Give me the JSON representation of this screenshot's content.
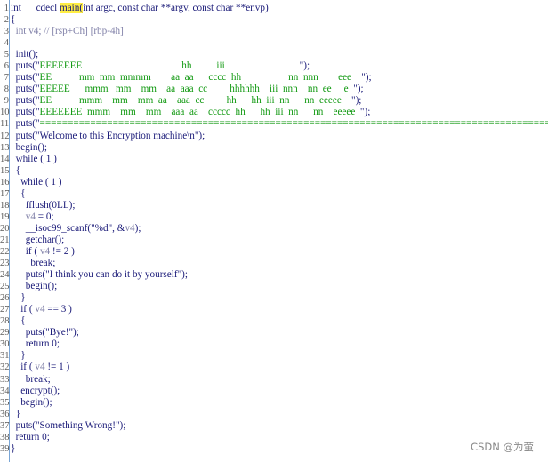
{
  "code": {
    "lines": [
      {
        "n": "1",
        "tokens": [
          {
            "t": "int  __cdecl ",
            "c": "code"
          },
          {
            "t": "main(",
            "c": "hl"
          },
          {
            "t": "int argc, const char **argv, const char **envp)",
            "c": "code"
          }
        ]
      },
      {
        "n": "2",
        "tokens": [
          {
            "t": "{",
            "c": "code"
          }
        ]
      },
      {
        "n": "3",
        "tokens": [
          {
            "t": "  int v4; // ",
            "c": "gray"
          },
          {
            "t": "[rsp+Ch] [rbp-4h]",
            "c": "gray"
          }
        ]
      },
      {
        "n": "4",
        "tokens": [
          {
            "t": "",
            "c": "code"
          }
        ]
      },
      {
        "n": "5",
        "tokens": [
          {
            "t": "  init();",
            "c": "code"
          }
        ]
      },
      {
        "n": "6",
        "tokens": [
          {
            "t": "  puts(\"",
            "c": "code"
          },
          {
            "t": "EEEEEEE                                        hh          iii                              ",
            "c": "str"
          },
          {
            "t": "\");",
            "c": "code"
          }
        ]
      },
      {
        "n": "7",
        "tokens": [
          {
            "t": "  puts(\"",
            "c": "code"
          },
          {
            "t": "EE           mm  mm  mmmm        aa  aa      cccc  hh                   nn  nnn        eee    ",
            "c": "str"
          },
          {
            "t": "\");",
            "c": "code"
          }
        ]
      },
      {
        "n": "8",
        "tokens": [
          {
            "t": "  puts(\"",
            "c": "code"
          },
          {
            "t": "EEEEE      mmm   mm    mm    aa  aaa  cc         hhhhhh    iii  nnn    nn  ee     e  ",
            "c": "str"
          },
          {
            "t": "\");",
            "c": "code"
          }
        ]
      },
      {
        "n": "9",
        "tokens": [
          {
            "t": "  puts(\"",
            "c": "code"
          },
          {
            "t": "EE           mmm    mm    mm  aa    aaa  cc         hh      hh  iii  nn      nn  eeeee    ",
            "c": "str"
          },
          {
            "t": "\");",
            "c": "code"
          }
        ]
      },
      {
        "n": "10",
        "tokens": [
          {
            "t": "  puts(\"",
            "c": "code"
          },
          {
            "t": "EEEEEEE  mmm    mm    mm    aaa  aa    ccccc  hh      hh  iii  nn      nn    eeeee  ",
            "c": "str"
          },
          {
            "t": "\");",
            "c": "code"
          }
        ]
      },
      {
        "n": "11",
        "tokens": [
          {
            "t": "  puts(\"",
            "c": "code"
          },
          {
            "t": "=============================================================================================",
            "c": "str"
          },
          {
            "t": "\");",
            "c": "code"
          }
        ]
      },
      {
        "n": "12",
        "tokens": [
          {
            "t": "  puts(\"Welcome to this Encryption machine\\n\");",
            "c": "code"
          }
        ]
      },
      {
        "n": "13",
        "tokens": [
          {
            "t": "  begin();",
            "c": "code"
          }
        ]
      },
      {
        "n": "14",
        "tokens": [
          {
            "t": "  while ( 1 )",
            "c": "code"
          }
        ]
      },
      {
        "n": "15",
        "tokens": [
          {
            "t": "  {",
            "c": "code"
          }
        ]
      },
      {
        "n": "16",
        "tokens": [
          {
            "t": "    while ( 1 )",
            "c": "code"
          }
        ]
      },
      {
        "n": "17",
        "tokens": [
          {
            "t": "    {",
            "c": "code"
          }
        ]
      },
      {
        "n": "18",
        "tokens": [
          {
            "t": "      fflush(0LL);",
            "c": "code"
          }
        ]
      },
      {
        "n": "19",
        "tokens": [
          {
            "t": "      ",
            "c": "code"
          },
          {
            "t": "v4",
            "c": "gray"
          },
          {
            "t": " = 0;",
            "c": "code"
          }
        ]
      },
      {
        "n": "20",
        "tokens": [
          {
            "t": "      __isoc99_scanf(\"%d\", &",
            "c": "code"
          },
          {
            "t": "v4",
            "c": "gray"
          },
          {
            "t": ");",
            "c": "code"
          }
        ]
      },
      {
        "n": "21",
        "tokens": [
          {
            "t": "      getchar();",
            "c": "code"
          }
        ]
      },
      {
        "n": "22",
        "tokens": [
          {
            "t": "      if ( ",
            "c": "code"
          },
          {
            "t": "v4",
            "c": "gray"
          },
          {
            "t": " != 2 )",
            "c": "code"
          }
        ]
      },
      {
        "n": "23",
        "tokens": [
          {
            "t": "        break;",
            "c": "code"
          }
        ]
      },
      {
        "n": "24",
        "tokens": [
          {
            "t": "      puts(\"I think you can do it by yourself\");",
            "c": "code"
          }
        ]
      },
      {
        "n": "25",
        "tokens": [
          {
            "t": "      begin();",
            "c": "code"
          }
        ]
      },
      {
        "n": "26",
        "tokens": [
          {
            "t": "    }",
            "c": "code"
          }
        ]
      },
      {
        "n": "27",
        "tokens": [
          {
            "t": "    if ( ",
            "c": "code"
          },
          {
            "t": "v4",
            "c": "gray"
          },
          {
            "t": " == 3 )",
            "c": "code"
          }
        ]
      },
      {
        "n": "28",
        "tokens": [
          {
            "t": "    {",
            "c": "code"
          }
        ]
      },
      {
        "n": "29",
        "tokens": [
          {
            "t": "      puts(\"Bye!\");",
            "c": "code"
          }
        ]
      },
      {
        "n": "30",
        "tokens": [
          {
            "t": "      return 0;",
            "c": "code"
          }
        ]
      },
      {
        "n": "31",
        "tokens": [
          {
            "t": "    }",
            "c": "code"
          }
        ]
      },
      {
        "n": "32",
        "tokens": [
          {
            "t": "    if ( ",
            "c": "code"
          },
          {
            "t": "v4",
            "c": "gray"
          },
          {
            "t": " != 1 )",
            "c": "code"
          }
        ]
      },
      {
        "n": "33",
        "tokens": [
          {
            "t": "      break;",
            "c": "code"
          }
        ]
      },
      {
        "n": "34",
        "tokens": [
          {
            "t": "    encrypt();",
            "c": "code"
          }
        ]
      },
      {
        "n": "35",
        "tokens": [
          {
            "t": "    begin();",
            "c": "code"
          }
        ]
      },
      {
        "n": "36",
        "tokens": [
          {
            "t": "  }",
            "c": "code"
          }
        ]
      },
      {
        "n": "37",
        "tokens": [
          {
            "t": "  puts(\"Something Wrong!\");",
            "c": "code"
          }
        ]
      },
      {
        "n": "38",
        "tokens": [
          {
            "t": "  return 0;",
            "c": "code"
          }
        ]
      },
      {
        "n": "39",
        "tokens": [
          {
            "t": "}",
            "c": "code"
          }
        ]
      }
    ]
  },
  "colors": {
    "code": "#1a1a78",
    "string": "#119911",
    "comment": "#8080a8",
    "highlight": "#ffee44",
    "gutter_border": "#7aa6d6"
  },
  "watermark": "CSDN @为萤"
}
